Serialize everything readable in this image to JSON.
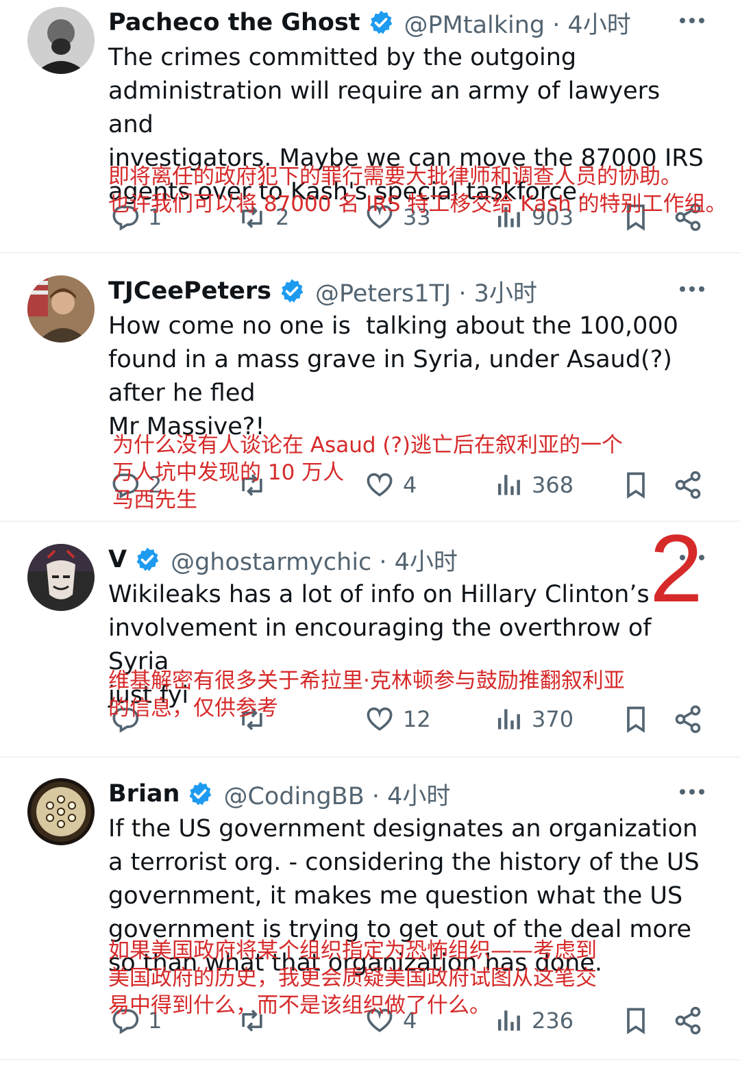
{
  "tweets": [
    {
      "name": "Pacheco the Ghost",
      "handle": "@PMtalking · 4小时",
      "text": "The crimes committed by the outgoing\nadministration will require an army of lawyers and\ninvestigators. Maybe we can move the 87000 IRS\nagents over to Kash's special taskforce.",
      "translation": "即将离任的政府犯下的罪行需要大批律师和调查人员的协助。\n也许我们可以将 87000 名 IRS 特工移交给 Kash 的特别工作组。",
      "replies": "1",
      "retweets": "2",
      "likes": "33",
      "views": "903"
    },
    {
      "name": "TJCeePeters",
      "handle": "@Peters1TJ · 3小时",
      "text": "How come no one is  talking about the 100,000\nfound in a mass grave in Syria, under Asaud(?)\nafter he fled\nMr Massive?!",
      "translation": "为什么没有人谈论在 Asaud (?)逃亡后在叙利亚的一个\n万人坑中发现的 10 万人\n马西先生",
      "replies": "2",
      "retweets": "",
      "likes": "4",
      "views": "368"
    },
    {
      "name": "V",
      "handle": "@ghostarmychic · 4小时",
      "text": "Wikileaks has a lot of info on Hillary Clinton’s\ninvolvement in encouraging the overthrow of Syria\njust fyi",
      "translation": "维基解密有很多关于希拉里·克林顿参与鼓励推翻叙利亚\n的信息，仅供参考",
      "replies": "",
      "retweets": "",
      "likes": "12",
      "views": "370"
    },
    {
      "name": "Brian",
      "handle": "@CodingBB · 4小时",
      "text": "If the US government designates an organization\na terrorist org. - considering the history of the US\ngovernment, it makes me question what the US\ngovernment is trying to get out of the deal more\nso than what that organization has done.",
      "translation": "如果美国政府将某个组织指定为恐怖组织——考虑到\n美国政府的历史，我更会质疑美国政府试图从这笔交\n易中得到什么，而不是该组织做了什么。",
      "replies": "1",
      "retweets": "",
      "likes": "4",
      "views": "236"
    }
  ],
  "annotation_number": "2",
  "colors": {
    "accent": "#1d9bf0",
    "annotation": "#d62a2a",
    "muted": "#536471"
  },
  "icons": [
    "verified-badge-icon",
    "more-options-icon",
    "reply-icon",
    "retweet-icon",
    "like-icon",
    "views-icon",
    "bookmark-icon",
    "share-icon"
  ]
}
